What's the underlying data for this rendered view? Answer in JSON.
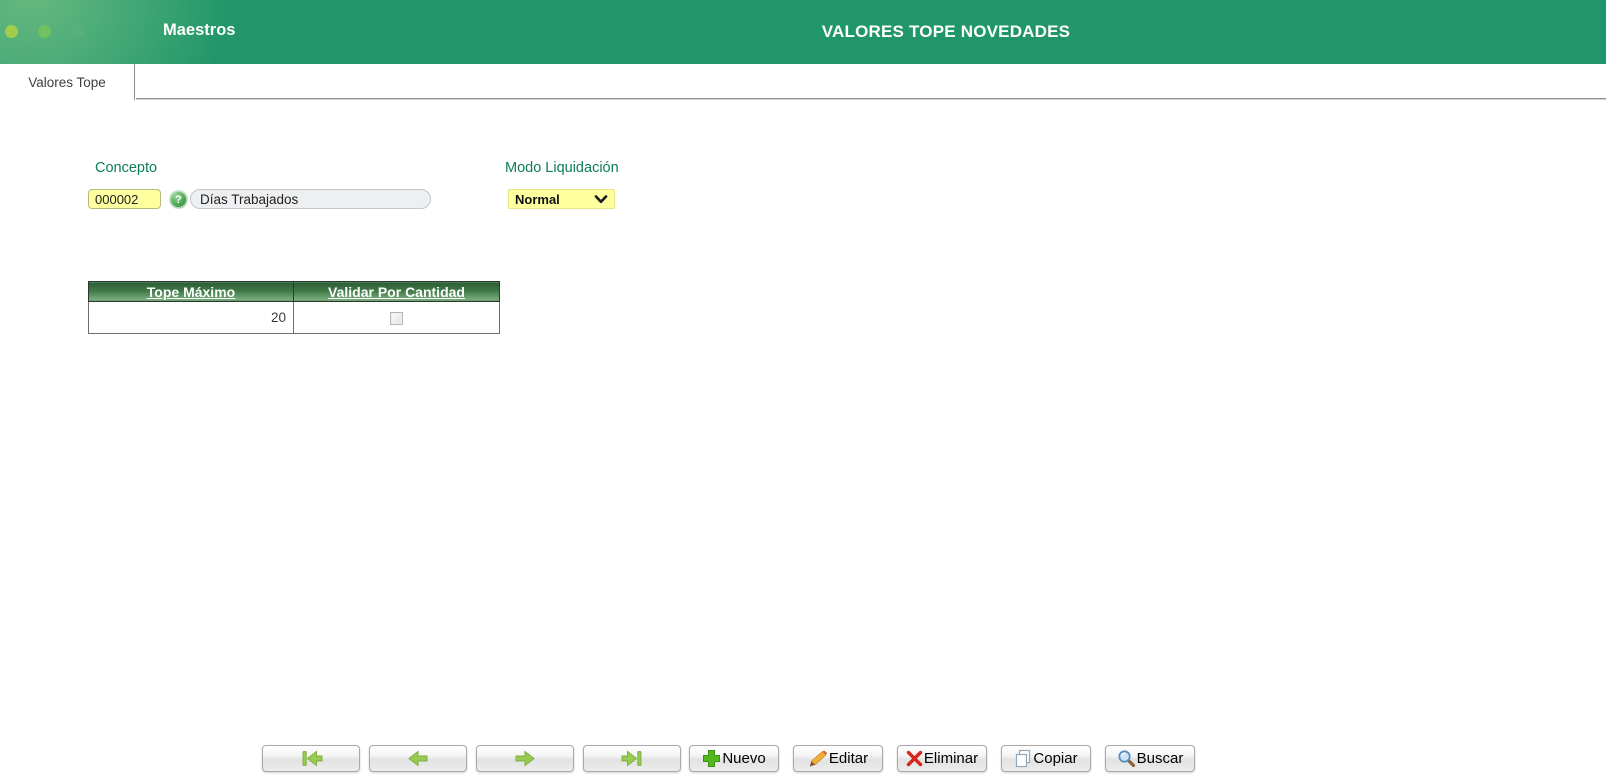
{
  "header": {
    "app_title": "Maestros",
    "page_title": "VALORES TOPE NOVEDADES"
  },
  "tabs": [
    {
      "label": "Valores Tope",
      "active": true
    }
  ],
  "form": {
    "concepto": {
      "label": "Concepto",
      "code": "000002",
      "description": "Días Trabajados",
      "help_glyph": "?"
    },
    "modo_liquidacion": {
      "label": "Modo Liquidación",
      "selected": "Normal"
    }
  },
  "grid": {
    "columns": [
      {
        "label": "Tope Máximo"
      },
      {
        "label": "Validar Por Cantidad"
      }
    ],
    "rows": [
      {
        "tope_maximo": "20",
        "validar_por_cantidad_checked": false
      }
    ]
  },
  "toolbar": {
    "nav": [
      {
        "name": "first",
        "icon": "first-record-icon"
      },
      {
        "name": "previous",
        "icon": "previous-record-icon"
      },
      {
        "name": "next",
        "icon": "next-record-icon"
      },
      {
        "name": "last",
        "icon": "last-record-icon"
      }
    ],
    "actions": [
      {
        "label": "Nuevo",
        "icon": "plus-icon"
      },
      {
        "label": "Editar",
        "icon": "pencil-icon"
      },
      {
        "label": "Eliminar",
        "icon": "delete-x-icon"
      },
      {
        "label": "Copiar",
        "icon": "copy-icon"
      },
      {
        "label": "Buscar",
        "icon": "search-icon"
      }
    ]
  },
  "colors": {
    "header_green": "#21966a",
    "field_yellow": "#feff9e",
    "label_green": "#0e7e55",
    "table_header_dark": "#2e5c36",
    "table_header_light": "#78aa7b",
    "arrow_green": "#97cb52",
    "delete_red": "#d9261c"
  }
}
